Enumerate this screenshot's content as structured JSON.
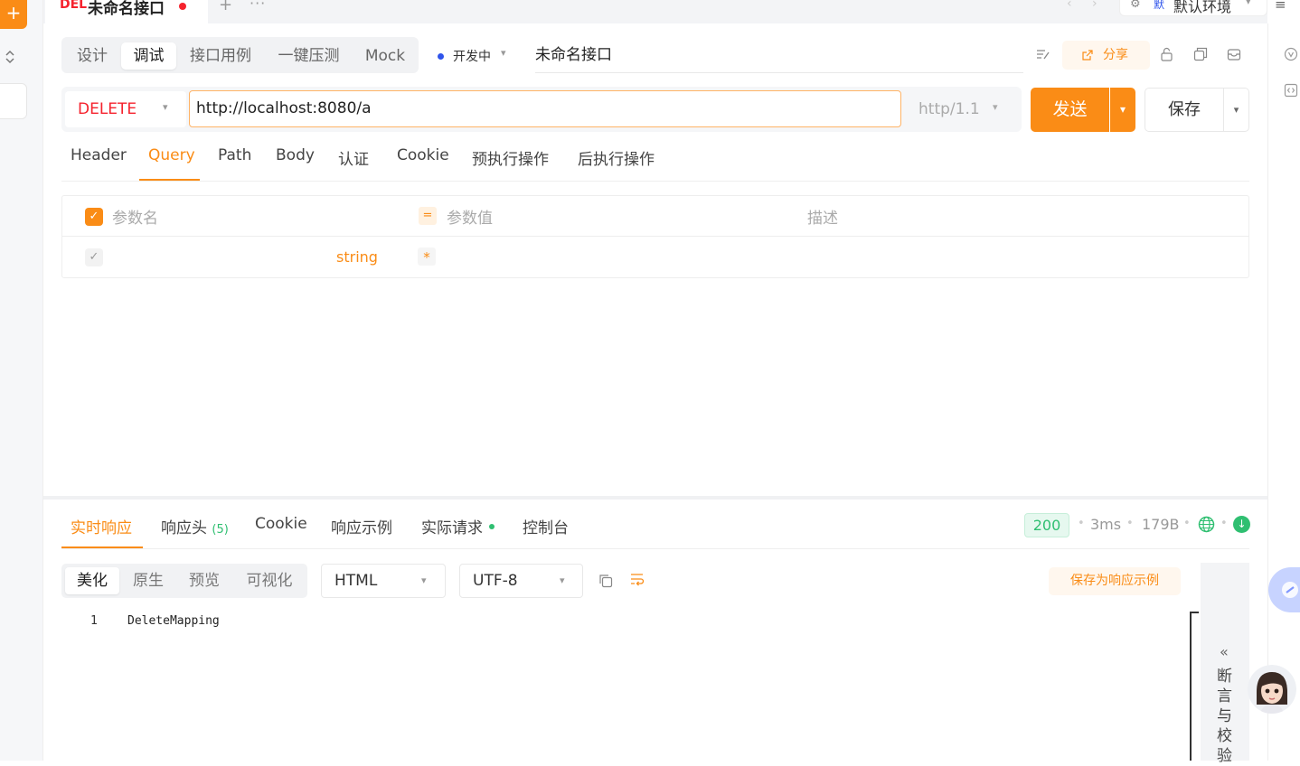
{
  "left_bar": {
    "add_label": "+"
  },
  "tab": {
    "method": "DEL",
    "title": "未命名接口",
    "plus": "+",
    "more": "···"
  },
  "environment": {
    "badge": "默",
    "name": "默认环境"
  },
  "modes": [
    "设计",
    "调试",
    "接口用例",
    "一键压测",
    "Mock"
  ],
  "active_mode": "调试",
  "status": {
    "label": "开发中"
  },
  "api_name": "未命名接口",
  "share_label": "分享",
  "request": {
    "method": "DELETE",
    "url": "http://localhost:8080/a",
    "protocol": "http/1.1",
    "send_label": "发送",
    "save_label": "保存"
  },
  "request_tabs": [
    "Header",
    "Query",
    "Path",
    "Body",
    "认证",
    "Cookie",
    "预执行操作",
    "后执行操作"
  ],
  "active_request_tab": "Query",
  "params_table": {
    "headers": {
      "name": "参数名",
      "eq": "=",
      "value": "参数值",
      "desc": "描述"
    },
    "rows": [
      {
        "type": "string",
        "required": "*"
      }
    ]
  },
  "response_tabs": {
    "realtime": "实时响应",
    "headers": "响应头",
    "headers_count": "(5)",
    "cookie": "Cookie",
    "example": "响应示例",
    "actual": "实际请求",
    "console": "控制台"
  },
  "response_meta": {
    "status": "200",
    "time": "3ms",
    "size": "179B"
  },
  "view_modes": [
    "美化",
    "原生",
    "预览",
    "可视化"
  ],
  "active_view": "美化",
  "content_type": "HTML",
  "charset": "UTF-8",
  "save_example_label": "保存为响应示例",
  "code": {
    "line": "1",
    "text": "DeleteMapping"
  },
  "assert_panel": {
    "chevron": "«",
    "label": "断言与校验"
  },
  "colors": {
    "accent": "#fa8c16",
    "danger": "#f5222d",
    "success": "#2fbf71",
    "status_dot": "#2f54eb"
  },
  "icons": [
    "collapse-icon",
    "gear-icon",
    "menu-icon",
    "format-icon",
    "share-icon",
    "lock-icon",
    "clone-icon",
    "archive-icon",
    "chevron-down-icon",
    "check-icon",
    "globe-icon",
    "download-icon",
    "copy-icon",
    "wrap-icon"
  ]
}
